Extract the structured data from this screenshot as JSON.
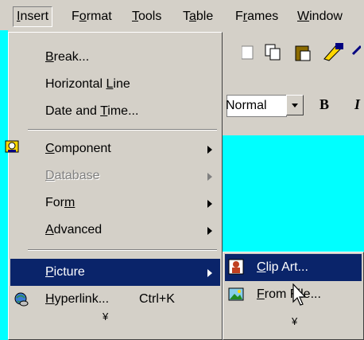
{
  "menubar": {
    "items": [
      {
        "pre": "",
        "acc": "I",
        "post": "nsert"
      },
      {
        "pre": "F",
        "acc": "o",
        "post": "rmat"
      },
      {
        "pre": "",
        "acc": "T",
        "post": "ools"
      },
      {
        "pre": "T",
        "acc": "a",
        "post": "ble"
      },
      {
        "pre": "F",
        "acc": "r",
        "post": "ames"
      },
      {
        "pre": "",
        "acc": "W",
        "post": "indow"
      }
    ]
  },
  "toolbar": {
    "style_value": "Normal",
    "bold": "B",
    "italic": "I"
  },
  "insert_menu": {
    "break": {
      "pre": "",
      "acc": "B",
      "post": "reak..."
    },
    "hline": {
      "pre": "Horizontal ",
      "acc": "L",
      "post": "ine"
    },
    "datetime": {
      "pre": "Date and ",
      "acc": "T",
      "post": "ime..."
    },
    "component": {
      "pre": "",
      "acc": "C",
      "post": "omponent"
    },
    "database": {
      "pre": "",
      "acc": "D",
      "post": "atabase"
    },
    "form": {
      "pre": "For",
      "acc": "m",
      "post": ""
    },
    "advanced": {
      "pre": "",
      "acc": "A",
      "post": "dvanced"
    },
    "picture": {
      "pre": "",
      "acc": "P",
      "post": "icture"
    },
    "hyperlink": {
      "pre": "",
      "acc": "H",
      "post": "yperlink...",
      "shortcut": "Ctrl+K"
    },
    "expand": "¥"
  },
  "picture_submenu": {
    "clipart": {
      "pre": "",
      "acc": "C",
      "post": "lip Art..."
    },
    "fromfile": {
      "pre": "",
      "acc": "F",
      "post": "rom File..."
    },
    "expand": "¥"
  },
  "colors": {
    "highlight": "#0a246a",
    "menu_bg": "#d4d0c8",
    "canvas": "#00ffff"
  },
  "icons": [
    "component-icon",
    "hyperlink-icon",
    "clipart-icon",
    "from-file-icon",
    "cursor-icon"
  ]
}
